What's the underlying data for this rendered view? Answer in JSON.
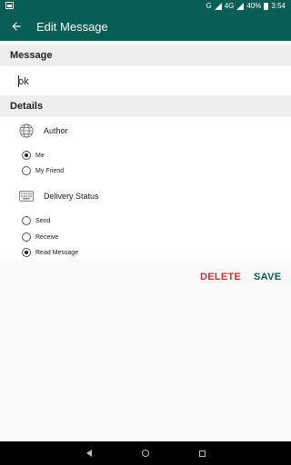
{
  "status_bar": {
    "network_label": "G",
    "lte_label": "4G",
    "battery_text": "40%",
    "time": "3:54"
  },
  "app_bar": {
    "title": "Edit Message",
    "back_icon": "arrow-left-icon"
  },
  "message_section": {
    "header": "Message",
    "input_value": "ok"
  },
  "details_section": {
    "header": "Details",
    "author": {
      "label": "Author",
      "icon": "globe-icon",
      "options": [
        "Me",
        "My Friend"
      ],
      "selected": "Me"
    },
    "delivery_status": {
      "label": "Delivery Status",
      "icon": "keyboard-icon",
      "options": [
        "Send",
        "Receive",
        "Read Message"
      ],
      "selected": "Read Message"
    }
  },
  "actions": {
    "delete_label": "DELETE",
    "save_label": "SAVE"
  },
  "colors": {
    "primary": "#075e54",
    "delete": "#d32f2f",
    "section_bg": "#eeeeee"
  }
}
